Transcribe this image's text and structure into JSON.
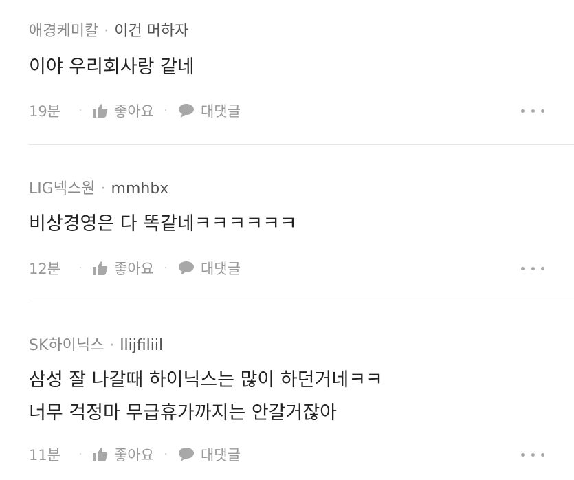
{
  "comments": [
    {
      "company": "애경케미칼",
      "separator": "·",
      "nickname": "이건 머하자",
      "lines": [
        "이야 우리회사랑 같네"
      ],
      "time": "19분",
      "like_label": "좋아요",
      "reply_label": "대댓글"
    },
    {
      "company": "LIG넥스원",
      "separator": "·",
      "nickname": "mmhbx",
      "lines": [
        "비상경영은 다 똑같네ㅋㅋㅋㅋㅋㅋ"
      ],
      "time": "12분",
      "like_label": "좋아요",
      "reply_label": "대댓글"
    },
    {
      "company": "SK하이닉스",
      "separator": "·",
      "nickname": "llijfiliil",
      "lines": [
        "삼성 잘 나갈때 하이닉스는 많이 하던거네ㅋㅋ",
        "너무 걱정마 무급휴가까지는 안갈거잖아"
      ],
      "time": "11분",
      "like_label": "좋아요",
      "reply_label": "대댓글"
    }
  ],
  "icons": {
    "like": "thumbs-up-icon",
    "reply": "speech-bubble-icon",
    "more": "more-dots-icon"
  },
  "colors": {
    "text_primary": "#222222",
    "text_secondary": "#8a8a8a",
    "divider": "#e5e5e5"
  }
}
